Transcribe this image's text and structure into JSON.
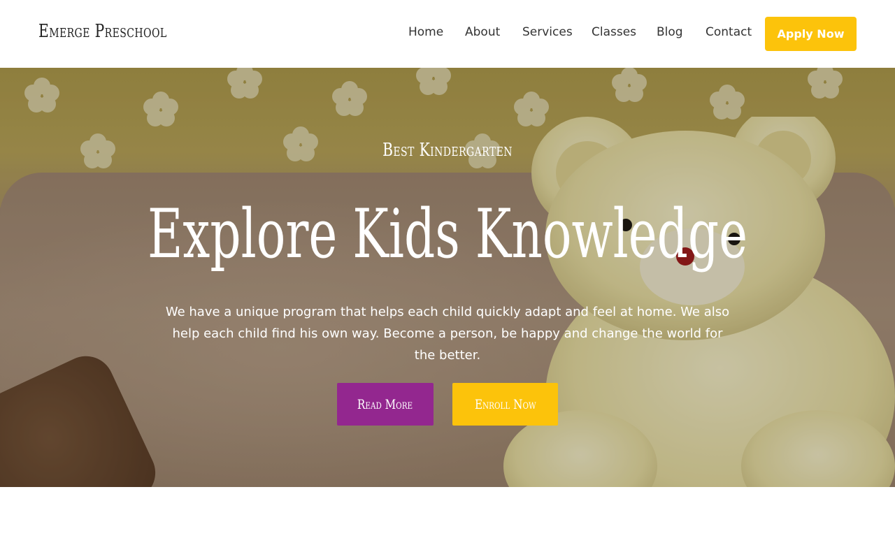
{
  "header": {
    "logo": "Emerge Preschool",
    "nav": {
      "home": "Home",
      "about": "About",
      "services": "Services",
      "classes": "Classes",
      "blog": "Blog",
      "contact": "Contact"
    },
    "cta_label": "Apply Now",
    "cta_color": "#fcc30b"
  },
  "hero": {
    "eyebrow": "Best Kindergarten",
    "title": "Explore Kids Knowledge",
    "description": "We have a unique program that helps each child quickly adapt and feel at home. We also help each child find his own way. Become a person, be happy and change the world for the better.",
    "buttons": {
      "read_more": "Read More",
      "enroll_now": "Enroll Now"
    },
    "background_image": "teddy-bear-on-sofa",
    "colors": {
      "primary_purple": "#93278f",
      "accent_yellow": "#fcc30b"
    }
  }
}
